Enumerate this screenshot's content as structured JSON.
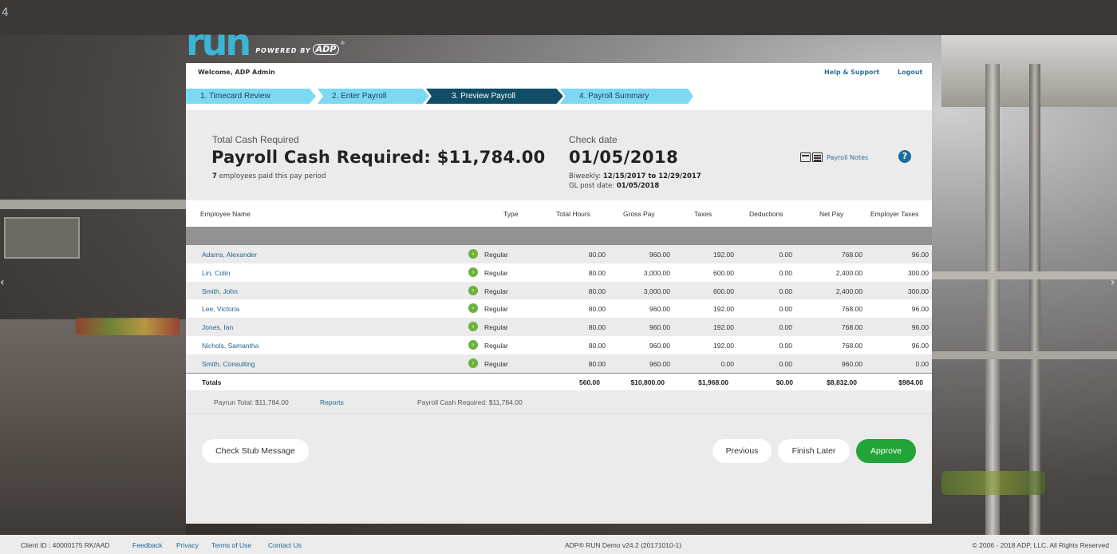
{
  "corner_number": "4",
  "logo": {
    "brand": "run",
    "powered_by": "POWERED BY",
    "adp": "ADP",
    "reg": "®"
  },
  "topbar": {
    "welcome": "Welcome, ADP Admin",
    "help": "Help & Support",
    "logout": "Logout"
  },
  "steps": [
    {
      "label": "1.  Timecard Review",
      "active": false
    },
    {
      "label": "2.  Enter Payroll",
      "active": false
    },
    {
      "label": "3.  Preview Payroll",
      "active": true
    },
    {
      "label": "4.  Payroll Summary",
      "active": false
    }
  ],
  "summary": {
    "total_cash_label": "Total Cash Required",
    "payroll_cash": "Payroll Cash Required: $11,784.00",
    "employees_count": "7",
    "employees_text": " employees paid this pay period",
    "check_date_label": "Check date",
    "check_date": "01/05/2018",
    "biweekly_label": "Biweekly: ",
    "biweekly_range": "12/15/2017  to  12/29/2017",
    "gl_label": "GL post date: ",
    "gl_date": "01/05/2018",
    "notes_label": "Payroll Notes",
    "help_icon": "?"
  },
  "table": {
    "headers": [
      "Employee Name",
      "Type",
      "Total Hours",
      "Gross Pay",
      "Taxes",
      "Deductions",
      "Net Pay",
      "Employer Taxes"
    ],
    "rows": [
      {
        "name": "Adams, Alexander",
        "type": "Regular",
        "hours": "80.00",
        "gross": "960.00",
        "taxes": "192.00",
        "ded": "0.00",
        "net": "768.00",
        "emp": "96.00"
      },
      {
        "name": "Lin, Colin",
        "type": "Regular",
        "hours": "80.00",
        "gross": "3,000.00",
        "taxes": "600.00",
        "ded": "0.00",
        "net": "2,400.00",
        "emp": "300.00"
      },
      {
        "name": "Smith, John",
        "type": "Regular",
        "hours": "80.00",
        "gross": "3,000.00",
        "taxes": "600.00",
        "ded": "0.00",
        "net": "2,400.00",
        "emp": "300.00"
      },
      {
        "name": "Lee, Victoria",
        "type": "Regular",
        "hours": "80.00",
        "gross": "960.00",
        "taxes": "192.00",
        "ded": "0.00",
        "net": "768.00",
        "emp": "96.00"
      },
      {
        "name": "Jones, Ian",
        "type": "Regular",
        "hours": "80.00",
        "gross": "960.00",
        "taxes": "192.00",
        "ded": "0.00",
        "net": "768.00",
        "emp": "96.00"
      },
      {
        "name": "Nichols, Samantha",
        "type": "Regular",
        "hours": "80.00",
        "gross": "960.00",
        "taxes": "192.00",
        "ded": "0.00",
        "net": "768.00",
        "emp": "96.00"
      },
      {
        "name": "Smith, Consulting",
        "type": "Regular",
        "hours": "80.00",
        "gross": "960.00",
        "taxes": "0.00",
        "ded": "0.00",
        "net": "960.00",
        "emp": "0.00"
      }
    ],
    "totals": {
      "label": "Totals",
      "hours": "560.00",
      "gross": "$10,800.00",
      "taxes": "$1,968.00",
      "ded": "$0.00",
      "net": "$8,832.00",
      "emp": "$984.00"
    }
  },
  "footrow": {
    "payrun_total": "Payrun Total: $11,784.00",
    "reports": "Reports",
    "payroll_cash": "Payroll Cash Required: $11,784.00"
  },
  "buttons": {
    "check_stub": "Check Stub Message",
    "previous": "Previous",
    "finish_later": "Finish Later",
    "approve": "Approve"
  },
  "footer": {
    "client_id": "Client ID : 40000175 RK/AAD",
    "feedback": "Feedback",
    "privacy": "Privacy",
    "terms": "Terms of Use",
    "contact": "Contact Us",
    "version": "ADP® RUN Demo v24.2 (20171010-1)",
    "copyright": "© 2006 - 2018 ADP, LLC. All Rights Reserved"
  },
  "colors": {
    "accent": "#7dd9f3",
    "active_step": "#0f4e66",
    "approve": "#22a437",
    "link": "#1f6591"
  },
  "icons": [
    "payroll-notes-icon",
    "help-icon",
    "go-arrow-icon"
  ]
}
